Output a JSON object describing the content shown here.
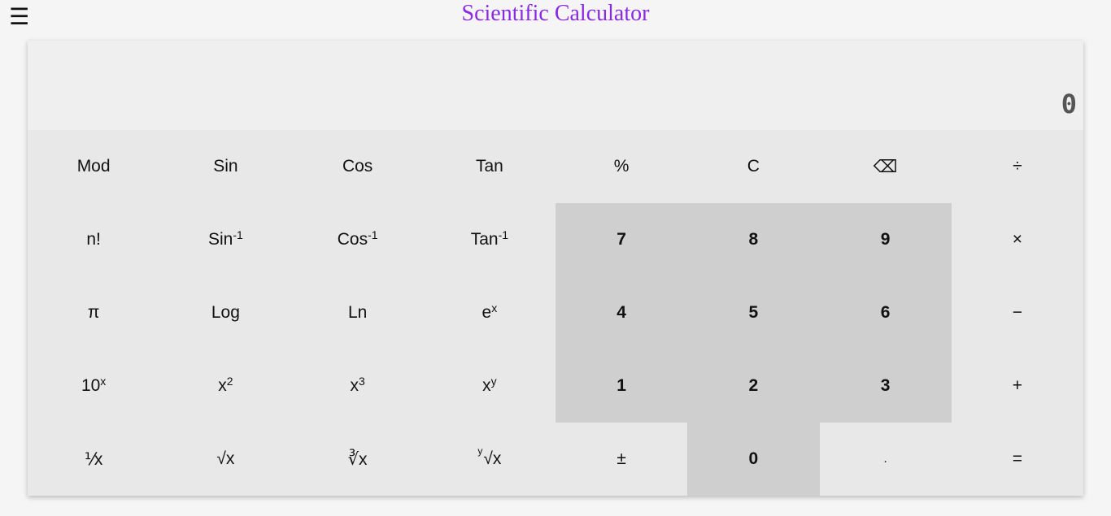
{
  "header": {
    "menu_icon": "hamburger-menu-icon",
    "menu_glyph": "☰",
    "title": "Scientific Calculator",
    "title_color": "#8a2be2"
  },
  "display": {
    "value": "0"
  },
  "keys": {
    "mod": "Mod",
    "sin": "Sin",
    "cos": "Cos",
    "tan": "Tan",
    "percent": "%",
    "clear": "C",
    "backspace": "⌫",
    "divide": "÷",
    "factorial": "n!",
    "asin_base": "Sin",
    "acos_base": "Cos",
    "atan_base": "Tan",
    "inverse_sup": "-1",
    "seven": "7",
    "eight": "8",
    "nine": "9",
    "multiply": "×",
    "pi": "π",
    "log": "Log",
    "ln": "Ln",
    "exp_base": "e",
    "exp_sup": "x",
    "four": "4",
    "five": "5",
    "six": "6",
    "minus": "−",
    "ten_pow_base": "10",
    "ten_pow_sup": "x",
    "square_base": "x",
    "square_sup": "2",
    "cube_base": "x",
    "cube_sup": "3",
    "pow_base": "x",
    "pow_sup": "y",
    "one": "1",
    "two": "2",
    "three": "3",
    "plus": "+",
    "reciprocal": "⅟x",
    "sqrt": "√x",
    "cbrt": "∛x",
    "yroot_index": "y",
    "yroot_body": "√x",
    "sign": "±",
    "zero": "0",
    "decimal": ".",
    "equals": "="
  },
  "colors": {
    "page_bg": "#f5f5f5",
    "keypad_bg": "#e8e8e8",
    "display_bg": "#efefef",
    "number_key_bg": "#cfcfcf",
    "display_text": "#555555"
  }
}
